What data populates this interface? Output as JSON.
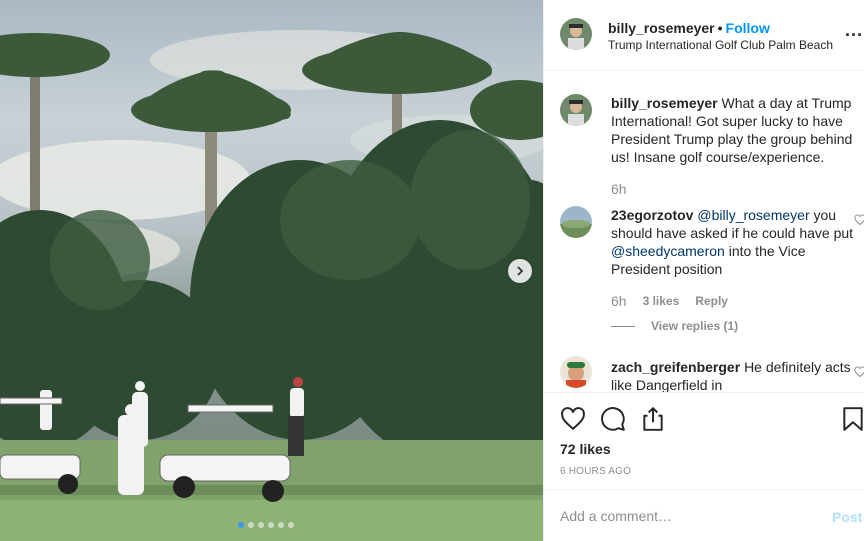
{
  "post": {
    "username": "billy_rosemeyer",
    "separator": "•",
    "follow_label": "Follow",
    "location": "Trump International Golf Club Palm Beach",
    "more_label": "..."
  },
  "photo": {
    "carousel_dots": 6,
    "active_dot": 0
  },
  "comments": [
    {
      "username": "billy_rosemeyer",
      "text": "What a day at Trump International! Got super lucky to have President Trump play the group behind us! Insane golf course/experience.",
      "time": "6h"
    },
    {
      "username": "23egorzotov",
      "mention1": "@billy_rosemeyer",
      "text_mid": "you should have asked if he could have put",
      "mention2": "@sheedycameron",
      "text_end": "into the Vice President position",
      "time": "6h",
      "likes": "3 likes",
      "reply_label": "Reply",
      "view_replies": "View replies (1)"
    },
    {
      "username": "zach_greifenberger",
      "text": "He definitely acts like Dangerfield in"
    }
  ],
  "actions": {
    "like_icon": "heart-icon",
    "comment_icon": "comment-icon",
    "share_icon": "share-icon",
    "save_icon": "bookmark-icon"
  },
  "likes_text": "72 likes",
  "posted_time": "6 hours ago",
  "add_comment": {
    "placeholder": "Add a comment…",
    "post_label": "Post"
  },
  "colors": {
    "link_blue": "#0095f6",
    "mention": "#00376b",
    "muted": "#8e8e8e",
    "post_disabled": "#b2dffc"
  }
}
